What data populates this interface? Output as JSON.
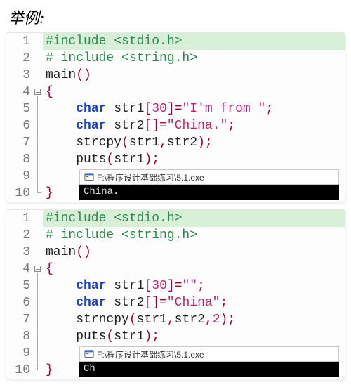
{
  "heading": "举例:",
  "blocks": [
    {
      "lines": [
        {
          "n": 1,
          "highlight": true,
          "fold": "none",
          "tokens": [
            {
              "c": "tok-pre",
              "t": "#include <stdio.h>"
            }
          ]
        },
        {
          "n": 2,
          "highlight": false,
          "fold": "none",
          "tokens": [
            {
              "c": "tok-pre",
              "t": "# include <string.h>"
            }
          ]
        },
        {
          "n": 3,
          "highlight": false,
          "fold": "none",
          "tokens": [
            {
              "c": "tok-plain",
              "t": "main"
            },
            {
              "c": "tok-punc",
              "t": "()"
            }
          ]
        },
        {
          "n": 4,
          "highlight": false,
          "fold": "start",
          "tokens": [
            {
              "c": "tok-brace",
              "t": "{"
            }
          ]
        },
        {
          "n": 5,
          "highlight": false,
          "fold": "mid",
          "tokens": [
            {
              "c": "tok-plain",
              "t": "    "
            },
            {
              "c": "tok-type",
              "t": "char"
            },
            {
              "c": "tok-plain",
              "t": " str1"
            },
            {
              "c": "tok-punc",
              "t": "["
            },
            {
              "c": "tok-num",
              "t": "30"
            },
            {
              "c": "tok-punc",
              "t": "]="
            },
            {
              "c": "tok-str",
              "t": "\"I'm from \""
            },
            {
              "c": "tok-punc",
              "t": ";"
            }
          ]
        },
        {
          "n": 6,
          "highlight": false,
          "fold": "mid",
          "tokens": [
            {
              "c": "tok-plain",
              "t": "    "
            },
            {
              "c": "tok-type",
              "t": "char"
            },
            {
              "c": "tok-plain",
              "t": " str2"
            },
            {
              "c": "tok-punc",
              "t": "[]="
            },
            {
              "c": "tok-str",
              "t": "\"China.\""
            },
            {
              "c": "tok-punc",
              "t": ";"
            }
          ]
        },
        {
          "n": 7,
          "highlight": false,
          "fold": "mid",
          "tokens": [
            {
              "c": "tok-plain",
              "t": "    strcpy"
            },
            {
              "c": "tok-punc",
              "t": "("
            },
            {
              "c": "tok-plain",
              "t": "str1"
            },
            {
              "c": "tok-punc",
              "t": ","
            },
            {
              "c": "tok-plain",
              "t": "str2"
            },
            {
              "c": "tok-punc",
              "t": ");"
            }
          ]
        },
        {
          "n": 8,
          "highlight": false,
          "fold": "mid",
          "tokens": [
            {
              "c": "tok-plain",
              "t": "    puts"
            },
            {
              "c": "tok-punc",
              "t": "("
            },
            {
              "c": "tok-plain",
              "t": "str1"
            },
            {
              "c": "tok-punc",
              "t": ");"
            }
          ]
        },
        {
          "n": 9,
          "highlight": false,
          "fold": "mid",
          "tokens": [
            {
              "c": "tok-plain",
              "t": ""
            }
          ]
        },
        {
          "n": 10,
          "highlight": false,
          "fold": "end",
          "tokens": [
            {
              "c": "tok-brace",
              "t": "}"
            }
          ]
        }
      ],
      "console": {
        "top_line": 8,
        "title": "F:\\程序设计基础练习\\5.1.exe",
        "output": "China."
      }
    },
    {
      "lines": [
        {
          "n": 1,
          "highlight": true,
          "fold": "none",
          "tokens": [
            {
              "c": "tok-pre",
              "t": "#include <stdio.h>"
            }
          ]
        },
        {
          "n": 2,
          "highlight": false,
          "fold": "none",
          "tokens": [
            {
              "c": "tok-pre",
              "t": "# include <string.h>"
            }
          ]
        },
        {
          "n": 3,
          "highlight": false,
          "fold": "none",
          "tokens": [
            {
              "c": "tok-plain",
              "t": "main"
            },
            {
              "c": "tok-punc",
              "t": "()"
            }
          ]
        },
        {
          "n": 4,
          "highlight": false,
          "fold": "start",
          "tokens": [
            {
              "c": "tok-brace",
              "t": "{"
            }
          ]
        },
        {
          "n": 5,
          "highlight": false,
          "fold": "mid",
          "tokens": [
            {
              "c": "tok-plain",
              "t": "    "
            },
            {
              "c": "tok-type",
              "t": "char"
            },
            {
              "c": "tok-plain",
              "t": " str1"
            },
            {
              "c": "tok-punc",
              "t": "["
            },
            {
              "c": "tok-num",
              "t": "30"
            },
            {
              "c": "tok-punc",
              "t": "]="
            },
            {
              "c": "tok-str",
              "t": "\"\""
            },
            {
              "c": "tok-punc",
              "t": ";"
            }
          ]
        },
        {
          "n": 6,
          "highlight": false,
          "fold": "mid",
          "tokens": [
            {
              "c": "tok-plain",
              "t": "    "
            },
            {
              "c": "tok-type",
              "t": "char"
            },
            {
              "c": "tok-plain",
              "t": " str2"
            },
            {
              "c": "tok-punc",
              "t": "[]="
            },
            {
              "c": "tok-str",
              "t": "\"China\""
            },
            {
              "c": "tok-punc",
              "t": ";"
            }
          ]
        },
        {
          "n": 7,
          "highlight": false,
          "fold": "mid",
          "tokens": [
            {
              "c": "tok-plain",
              "t": "    strncpy"
            },
            {
              "c": "tok-punc",
              "t": "("
            },
            {
              "c": "tok-plain",
              "t": "str1"
            },
            {
              "c": "tok-punc",
              "t": ","
            },
            {
              "c": "tok-plain",
              "t": "str2"
            },
            {
              "c": "tok-punc",
              "t": ","
            },
            {
              "c": "tok-num",
              "t": "2"
            },
            {
              "c": "tok-punc",
              "t": ");"
            }
          ]
        },
        {
          "n": 8,
          "highlight": false,
          "fold": "mid",
          "tokens": [
            {
              "c": "tok-plain",
              "t": "    puts"
            },
            {
              "c": "tok-punc",
              "t": "("
            },
            {
              "c": "tok-plain",
              "t": "str1"
            },
            {
              "c": "tok-punc",
              "t": ");"
            }
          ]
        },
        {
          "n": 9,
          "highlight": false,
          "fold": "mid",
          "tokens": [
            {
              "c": "tok-plain",
              "t": ""
            }
          ]
        },
        {
          "n": 10,
          "highlight": false,
          "fold": "end",
          "tokens": [
            {
              "c": "tok-brace",
              "t": "}"
            }
          ]
        }
      ],
      "console": {
        "top_line": 8,
        "title": "F:\\程序设计基础练习\\5.1.exe",
        "output": "Ch"
      }
    }
  ]
}
